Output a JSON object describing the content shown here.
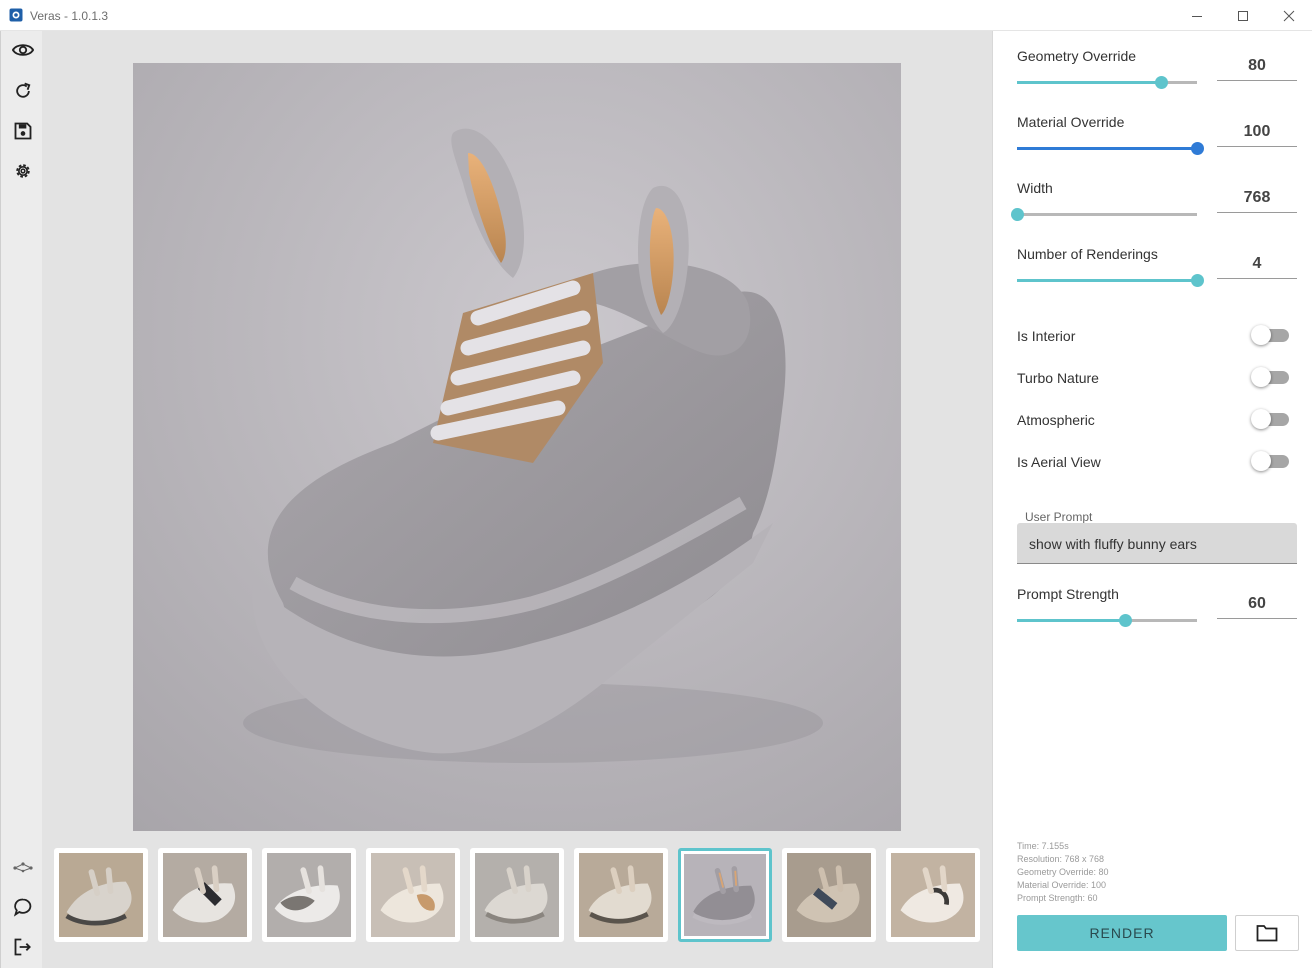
{
  "window": {
    "title": "Veras - 1.0.1.3",
    "app_icon": "veras-app-icon",
    "controls": [
      "minimize-icon",
      "maximize-icon",
      "close-icon"
    ]
  },
  "rail": {
    "top_icons": [
      "eye-icon",
      "refresh-icon",
      "save-icon",
      "settings-gear-icon"
    ],
    "bottom_icons": [
      "network-icon",
      "chat-bubble-icon",
      "exit-icon"
    ]
  },
  "main": {
    "image_alt": "Gray fluffy sneaker with bunny ears",
    "thumbnail_count": 9,
    "selected_thumbnail": 7
  },
  "panel": {
    "geometry_override": {
      "label": "Geometry Override",
      "value": "80",
      "level": 0.8
    },
    "material_override": {
      "label": "Material Override",
      "value": "100",
      "level": 1.0
    },
    "width": {
      "label": "Width",
      "value": "768",
      "level": 0.0
    },
    "number_of_renderings": {
      "label": "Number of Renderings",
      "value": "4",
      "level": 1.0
    },
    "toggles": [
      {
        "label": "Is Interior",
        "on": false
      },
      {
        "label": "Turbo Nature",
        "on": false
      },
      {
        "label": "Atmospheric",
        "on": false
      },
      {
        "label": "Is Aerial View",
        "on": false
      }
    ],
    "user_prompt": {
      "label": "User Prompt",
      "value": "show with fluffy bunny ears"
    },
    "prompt_strength": {
      "label": "Prompt Strength",
      "value": "60",
      "level": 0.6
    },
    "info": {
      "time": "Time: 7.155s",
      "resolution": "Resolution: 768 x 768",
      "geometry": "Geometry Override: 80",
      "material": "Material Override: 100",
      "strength": "Prompt Strength: 60"
    },
    "render_label": "RENDER",
    "folder_icon": "folder-icon"
  },
  "colors": {
    "accent": "#5ec4cc",
    "material_slider": "#2f7bd6",
    "render_button": "#66c6cc"
  }
}
